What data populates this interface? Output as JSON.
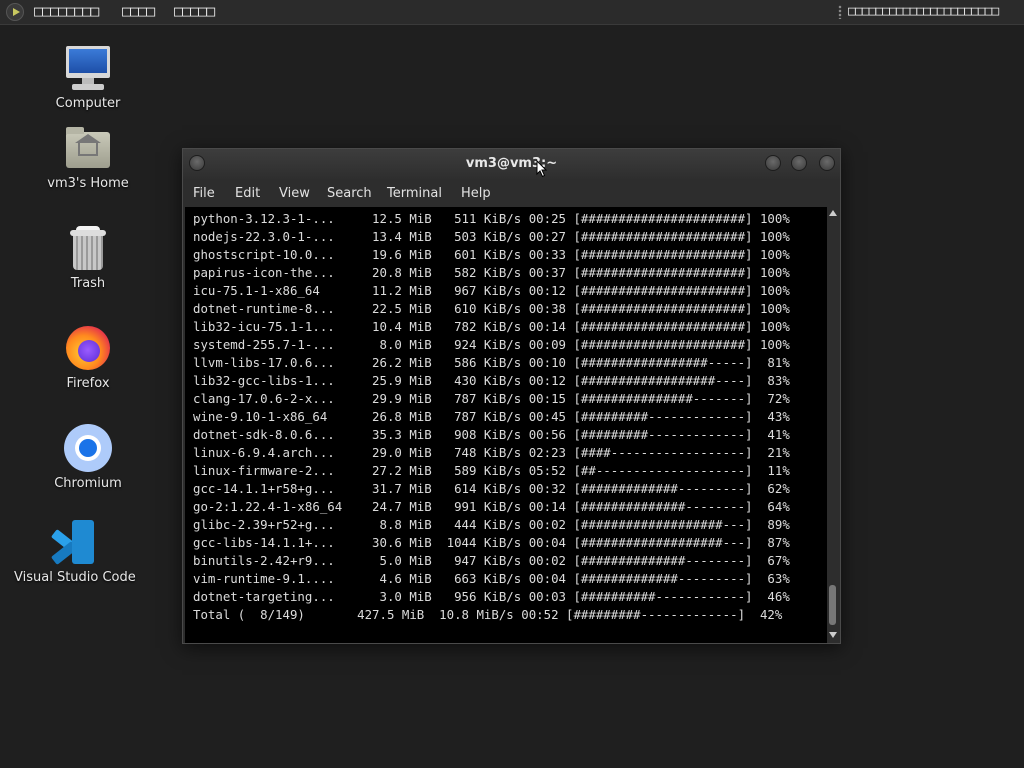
{
  "panel": {
    "menu_1": "□□□□□□□□",
    "menu_2": "□□□□",
    "menu_3": "□□□□□",
    "tray": "□□□□□□□□□□□□□□□□□□□□□□"
  },
  "desktop": {
    "icons": [
      {
        "label": "Computer"
      },
      {
        "label": "vm3's Home"
      },
      {
        "label": "Trash"
      },
      {
        "label": "Firefox"
      },
      {
        "label": "Chromium"
      },
      {
        "label": "Visual Studio Code"
      }
    ]
  },
  "terminal": {
    "title": "vm3@vm3:~",
    "menu": [
      "File",
      "Edit",
      "View",
      "Search",
      "Terminal",
      "Help"
    ],
    "lines": [
      "python-3.12.3-1-...     12.5 MiB   511 KiB/s 00:25 [######################] 100%",
      "nodejs-22.3.0-1-...     13.4 MiB   503 KiB/s 00:27 [######################] 100%",
      "ghostscript-10.0...     19.6 MiB   601 KiB/s 00:33 [######################] 100%",
      "papirus-icon-the...     20.8 MiB   582 KiB/s 00:37 [######################] 100%",
      "icu-75.1-1-x86_64       11.2 MiB   967 KiB/s 00:12 [######################] 100%",
      "dotnet-runtime-8...     22.5 MiB   610 KiB/s 00:38 [######################] 100%",
      "lib32-icu-75.1-1...     10.4 MiB   782 KiB/s 00:14 [######################] 100%",
      "systemd-255.7-1-...      8.0 MiB   924 KiB/s 00:09 [######################] 100%",
      "llvm-libs-17.0.6...     26.2 MiB   586 KiB/s 00:10 [#################-----]  81%",
      "lib32-gcc-libs-1...     25.9 MiB   430 KiB/s 00:12 [##################----]  83%",
      "clang-17.0.6-2-x...     29.9 MiB   787 KiB/s 00:15 [###############-------]  72%",
      "wine-9.10-1-x86_64      26.8 MiB   787 KiB/s 00:45 [#########-------------]  43%",
      "dotnet-sdk-8.0.6...     35.3 MiB   908 KiB/s 00:56 [#########-------------]  41%",
      "linux-6.9.4.arch...     29.0 MiB   748 KiB/s 02:23 [####------------------]  21%",
      "linux-firmware-2...     27.2 MiB   589 KiB/s 05:52 [##--------------------]  11%",
      "gcc-14.1.1+r58+g...     31.7 MiB   614 KiB/s 00:32 [#############---------]  62%",
      "go-2:1.22.4-1-x86_64    24.7 MiB   991 KiB/s 00:14 [##############--------]  64%",
      "glibc-2.39+r52+g...      8.8 MiB   444 KiB/s 00:02 [###################---]  89%",
      "gcc-libs-14.1.1+...     30.6 MiB  1044 KiB/s 00:04 [###################---]  87%",
      "binutils-2.42+r9...      5.0 MiB   947 KiB/s 00:02 [##############--------]  67%",
      "vim-runtime-9.1....      4.6 MiB   663 KiB/s 00:04 [#############---------]  63%",
      "dotnet-targeting...      3.0 MiB   956 KiB/s 00:03 [##########------------]  46%",
      "Total (  8/149)       427.5 MiB  10.8 MiB/s 00:52 [#########-------------]  42%"
    ]
  }
}
